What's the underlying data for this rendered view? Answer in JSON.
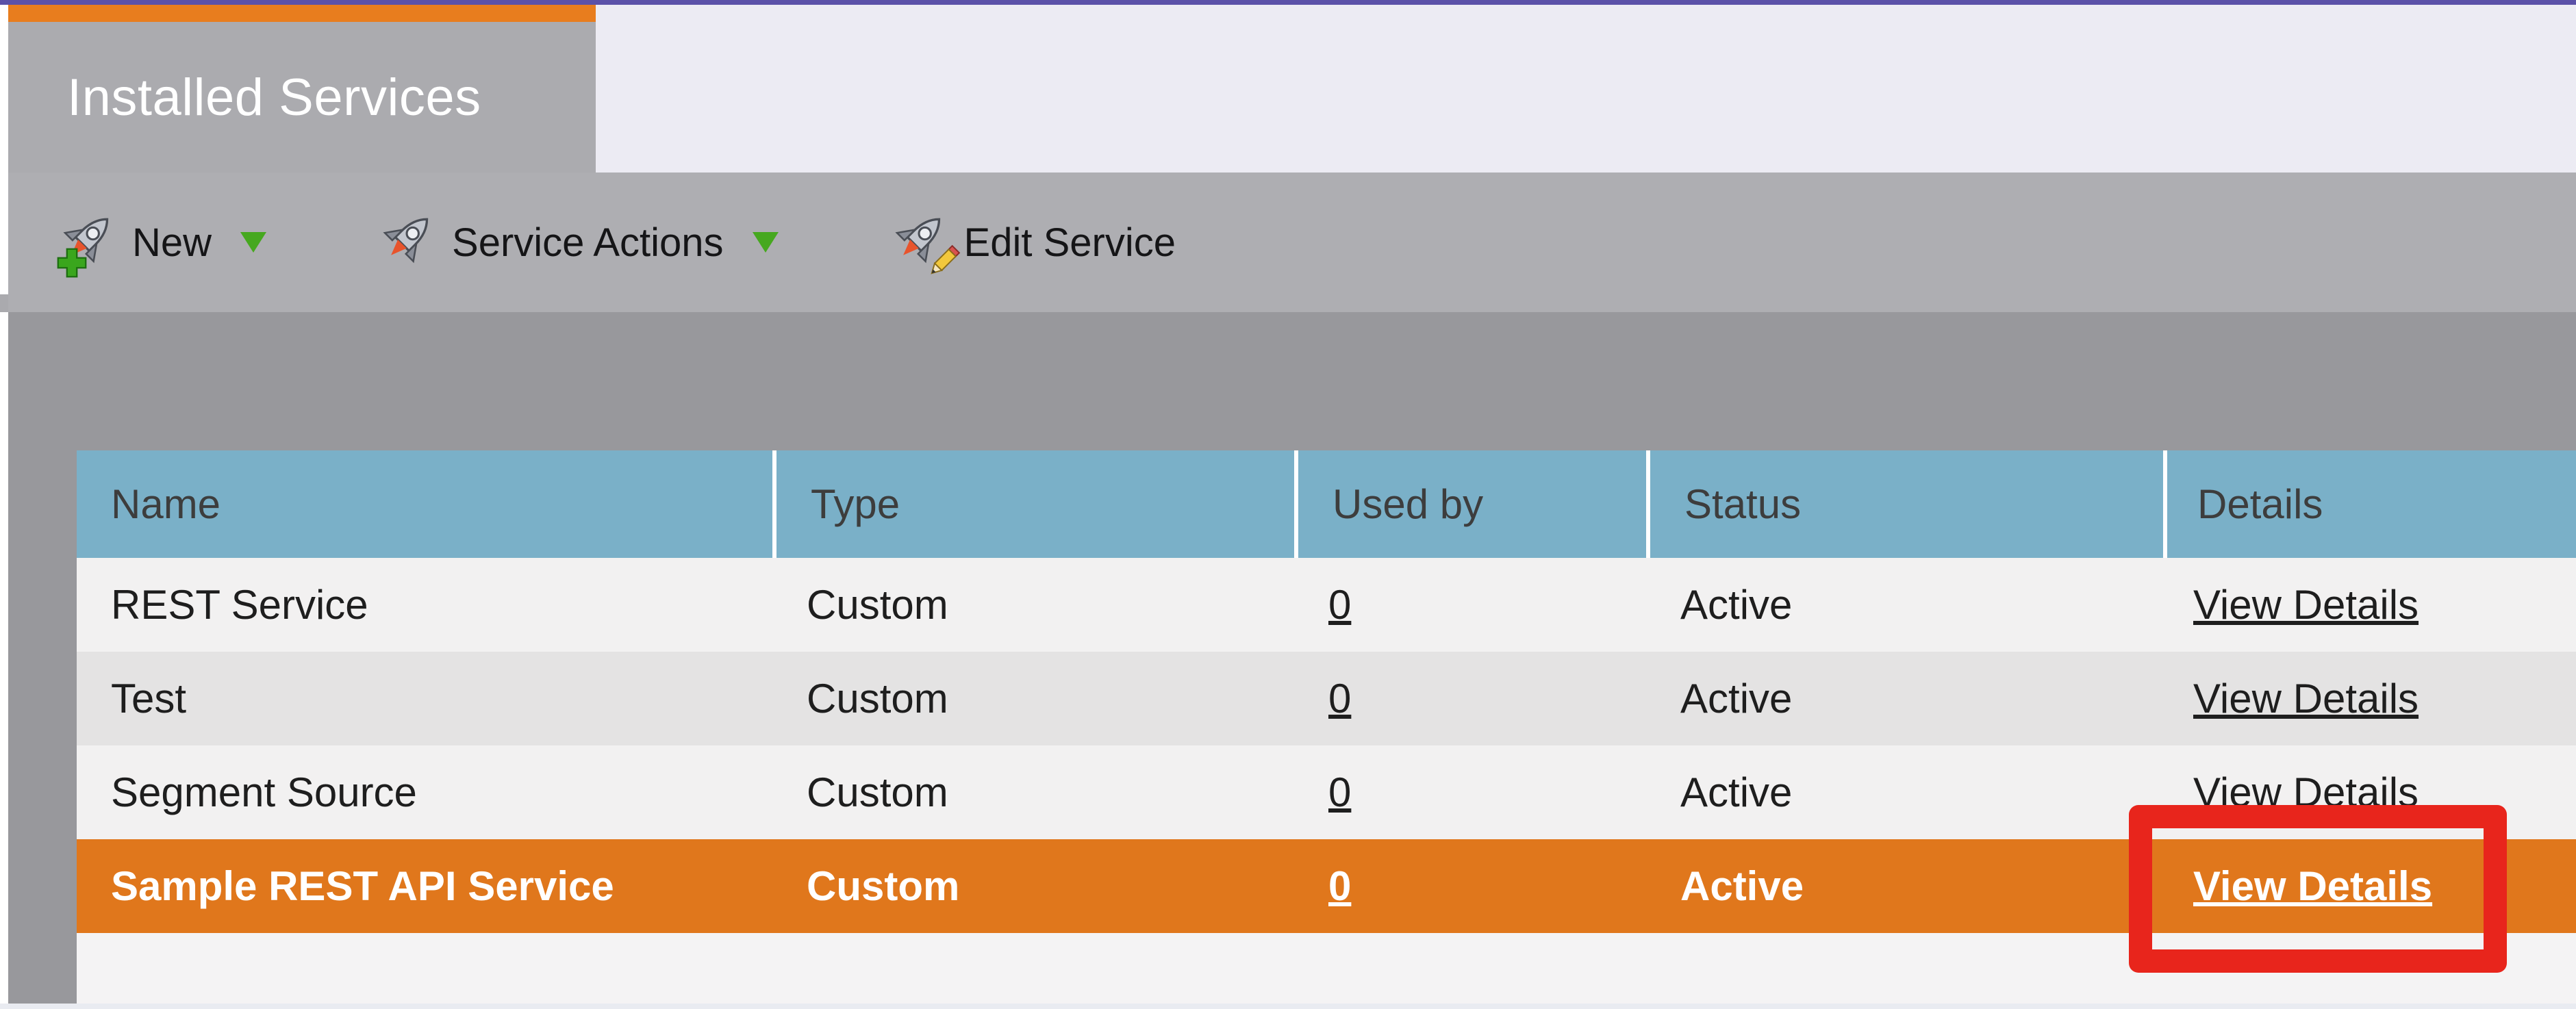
{
  "tab": {
    "label": "Installed Services"
  },
  "toolbar": {
    "buttons": [
      {
        "label": "New",
        "icon": "rocket-plus-icon",
        "has_dropdown": true
      },
      {
        "label": "Service Actions",
        "icon": "rocket-icon",
        "has_dropdown": true
      },
      {
        "label": "Edit Service",
        "icon": "rocket-pencil-icon",
        "has_dropdown": false
      }
    ]
  },
  "table": {
    "columns": [
      "Name",
      "Type",
      "Used by",
      "Status",
      "Details"
    ],
    "rows": [
      {
        "name": "REST Service",
        "type": "Custom",
        "used_by": "0",
        "status": "Active",
        "details": "View Details",
        "highlighted": false
      },
      {
        "name": "Test",
        "type": "Custom",
        "used_by": "0",
        "status": "Active",
        "details": "View Details",
        "highlighted": false
      },
      {
        "name": "Segment Source",
        "type": "Custom",
        "used_by": "0",
        "status": "Active",
        "details": "View Details",
        "highlighted": false
      },
      {
        "name": "Sample REST API Service",
        "type": "Custom",
        "used_by": "0",
        "status": "Active",
        "details": "View Details",
        "highlighted": true
      }
    ]
  },
  "annotation": {
    "shape": "rectangle",
    "color": "#e8251c",
    "target": "View Details link of highlighted row"
  },
  "colors": {
    "top_accent_purple": "#5b51a8",
    "tab_orange": "#e87d1e",
    "tab_gray": "#ababaf",
    "panel_lavender": "#ecebf3",
    "toolbar_gray": "#aeaeb2",
    "content_gray": "#98989c",
    "header_blue": "#7ab0c8",
    "row_light": "#f2f1f1",
    "row_alt": "#e4e3e3",
    "row_highlight_orange": "#e0771c",
    "annotation_red": "#e8251c"
  }
}
